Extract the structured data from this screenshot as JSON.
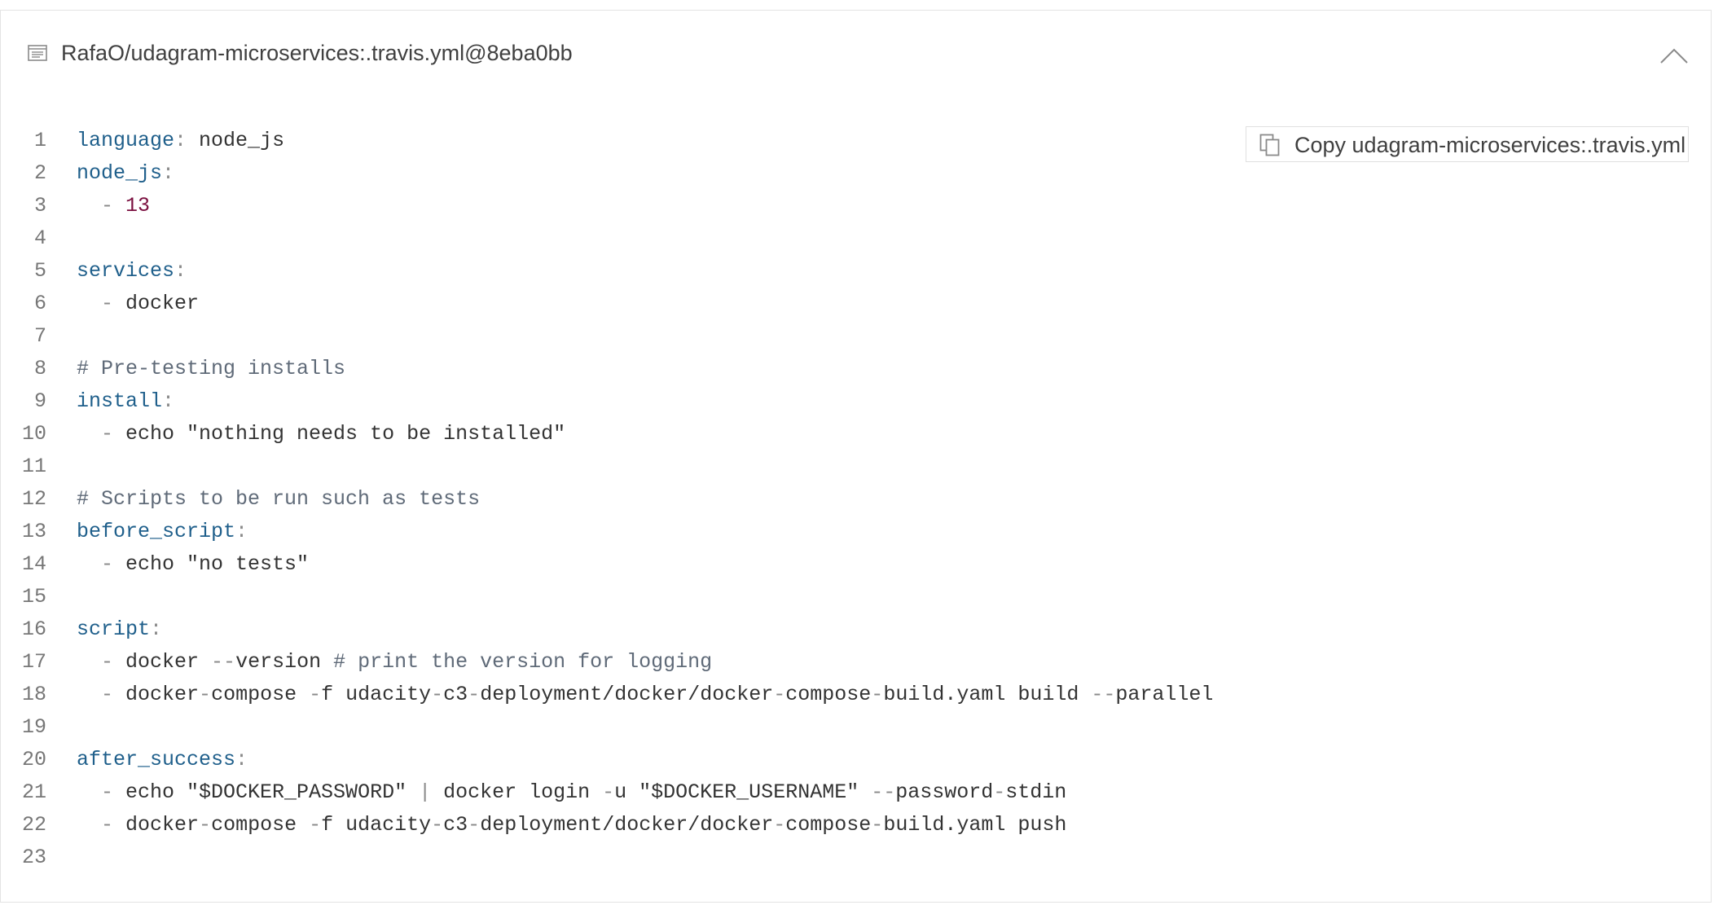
{
  "file_header": {
    "title": "RafaO/udagram-microservices:.travis.yml@8eba0bb",
    "file_icon": "file-text-icon",
    "collapse_icon": "chevron-up-icon"
  },
  "copy_button": {
    "label": "Copy udagram-microservices:.travis.yml",
    "icon": "copy-icon"
  },
  "colors": {
    "key": "#1f5f8b",
    "number": "#7a0f3f",
    "comment": "#5f6a78",
    "punctuation": "#8a8a8a",
    "text": "#333333",
    "border": "#e4e4e4"
  },
  "code": {
    "language": "yaml",
    "lines": [
      {
        "num": "1",
        "tokens": [
          {
            "t": "key",
            "v": "language"
          },
          {
            "t": "punct",
            "v": ":"
          },
          {
            "t": "text",
            "v": " node_js"
          }
        ]
      },
      {
        "num": "2",
        "tokens": [
          {
            "t": "key",
            "v": "node_js"
          },
          {
            "t": "punct",
            "v": ":"
          }
        ]
      },
      {
        "num": "3",
        "tokens": [
          {
            "t": "punct",
            "v": "  -"
          },
          {
            "t": "text",
            "v": " "
          },
          {
            "t": "num",
            "v": "13"
          }
        ]
      },
      {
        "num": "4",
        "tokens": []
      },
      {
        "num": "5",
        "tokens": [
          {
            "t": "key",
            "v": "services"
          },
          {
            "t": "punct",
            "v": ":"
          }
        ]
      },
      {
        "num": "6",
        "tokens": [
          {
            "t": "punct",
            "v": "  -"
          },
          {
            "t": "text",
            "v": " docker"
          }
        ]
      },
      {
        "num": "7",
        "tokens": []
      },
      {
        "num": "8",
        "tokens": [
          {
            "t": "comment",
            "v": "# Pre-testing installs"
          }
        ]
      },
      {
        "num": "9",
        "tokens": [
          {
            "t": "key",
            "v": "install"
          },
          {
            "t": "punct",
            "v": ":"
          }
        ]
      },
      {
        "num": "10",
        "tokens": [
          {
            "t": "punct",
            "v": "  -"
          },
          {
            "t": "text",
            "v": " echo \"nothing needs to be installed\""
          }
        ]
      },
      {
        "num": "11",
        "tokens": []
      },
      {
        "num": "12",
        "tokens": [
          {
            "t": "comment",
            "v": "# Scripts to be run such as tests"
          }
        ]
      },
      {
        "num": "13",
        "tokens": [
          {
            "t": "key",
            "v": "before_script"
          },
          {
            "t": "punct",
            "v": ":"
          }
        ]
      },
      {
        "num": "14",
        "tokens": [
          {
            "t": "punct",
            "v": "  -"
          },
          {
            "t": "text",
            "v": " echo \"no tests\""
          }
        ]
      },
      {
        "num": "15",
        "tokens": []
      },
      {
        "num": "16",
        "tokens": [
          {
            "t": "key",
            "v": "script"
          },
          {
            "t": "punct",
            "v": ":"
          }
        ]
      },
      {
        "num": "17",
        "tokens": [
          {
            "t": "punct",
            "v": "  -"
          },
          {
            "t": "text",
            "v": " docker "
          },
          {
            "t": "punct",
            "v": "--"
          },
          {
            "t": "text",
            "v": "version "
          },
          {
            "t": "comment",
            "v": "# print the version for logging"
          }
        ]
      },
      {
        "num": "18",
        "tokens": [
          {
            "t": "punct",
            "v": "  -"
          },
          {
            "t": "text",
            "v": " docker"
          },
          {
            "t": "punct",
            "v": "-"
          },
          {
            "t": "text",
            "v": "compose "
          },
          {
            "t": "punct",
            "v": "-"
          },
          {
            "t": "text",
            "v": "f udacity"
          },
          {
            "t": "punct",
            "v": "-"
          },
          {
            "t": "text",
            "v": "c3"
          },
          {
            "t": "punct",
            "v": "-"
          },
          {
            "t": "text",
            "v": "deployment/docker/docker"
          },
          {
            "t": "punct",
            "v": "-"
          },
          {
            "t": "text",
            "v": "compose"
          },
          {
            "t": "punct",
            "v": "-"
          },
          {
            "t": "text",
            "v": "build.yaml build "
          },
          {
            "t": "punct",
            "v": "--"
          },
          {
            "t": "text",
            "v": "parallel"
          }
        ]
      },
      {
        "num": "19",
        "tokens": []
      },
      {
        "num": "20",
        "tokens": [
          {
            "t": "key",
            "v": "after_success"
          },
          {
            "t": "punct",
            "v": ":"
          }
        ]
      },
      {
        "num": "21",
        "tokens": [
          {
            "t": "punct",
            "v": "  -"
          },
          {
            "t": "text",
            "v": " echo \"$DOCKER_PASSWORD\" "
          },
          {
            "t": "punct",
            "v": "|"
          },
          {
            "t": "text",
            "v": " docker login "
          },
          {
            "t": "punct",
            "v": "-"
          },
          {
            "t": "text",
            "v": "u \"$DOCKER_USERNAME\" "
          },
          {
            "t": "punct",
            "v": "--"
          },
          {
            "t": "text",
            "v": "password"
          },
          {
            "t": "punct",
            "v": "-"
          },
          {
            "t": "text",
            "v": "stdin"
          }
        ]
      },
      {
        "num": "22",
        "tokens": [
          {
            "t": "punct",
            "v": "  -"
          },
          {
            "t": "text",
            "v": " docker"
          },
          {
            "t": "punct",
            "v": "-"
          },
          {
            "t": "text",
            "v": "compose "
          },
          {
            "t": "punct",
            "v": "-"
          },
          {
            "t": "text",
            "v": "f udacity"
          },
          {
            "t": "punct",
            "v": "-"
          },
          {
            "t": "text",
            "v": "c3"
          },
          {
            "t": "punct",
            "v": "-"
          },
          {
            "t": "text",
            "v": "deployment/docker/docker"
          },
          {
            "t": "punct",
            "v": "-"
          },
          {
            "t": "text",
            "v": "compose"
          },
          {
            "t": "punct",
            "v": "-"
          },
          {
            "t": "text",
            "v": "build.yaml push"
          }
        ]
      },
      {
        "num": "23",
        "tokens": []
      }
    ]
  }
}
